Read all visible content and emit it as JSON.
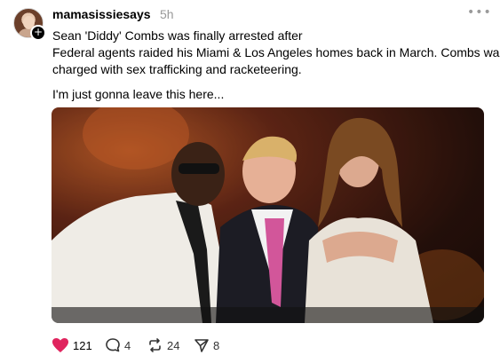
{
  "post": {
    "username": "mamasissiesays",
    "time": "5h",
    "more_icon": "more-horizontal-icon",
    "follow_icon": "plus-icon",
    "text_lines": [
      "Sean 'Diddy' Combs was finally arrested after",
      "Federal agents raided his Miami & Los Angeles homes back in March. Combs was",
      "charged with sex trafficking and racketeering."
    ],
    "text_extra": "I'm just gonna leave this here...",
    "image_icon": "photo-image"
  },
  "actions": {
    "like": {
      "icon": "heart-icon",
      "count": "121",
      "color": "#e0245e"
    },
    "comment": {
      "icon": "comment-icon",
      "count": "4"
    },
    "repost": {
      "icon": "repost-icon",
      "count": "24"
    },
    "share": {
      "icon": "send-icon",
      "count": "8"
    }
  }
}
